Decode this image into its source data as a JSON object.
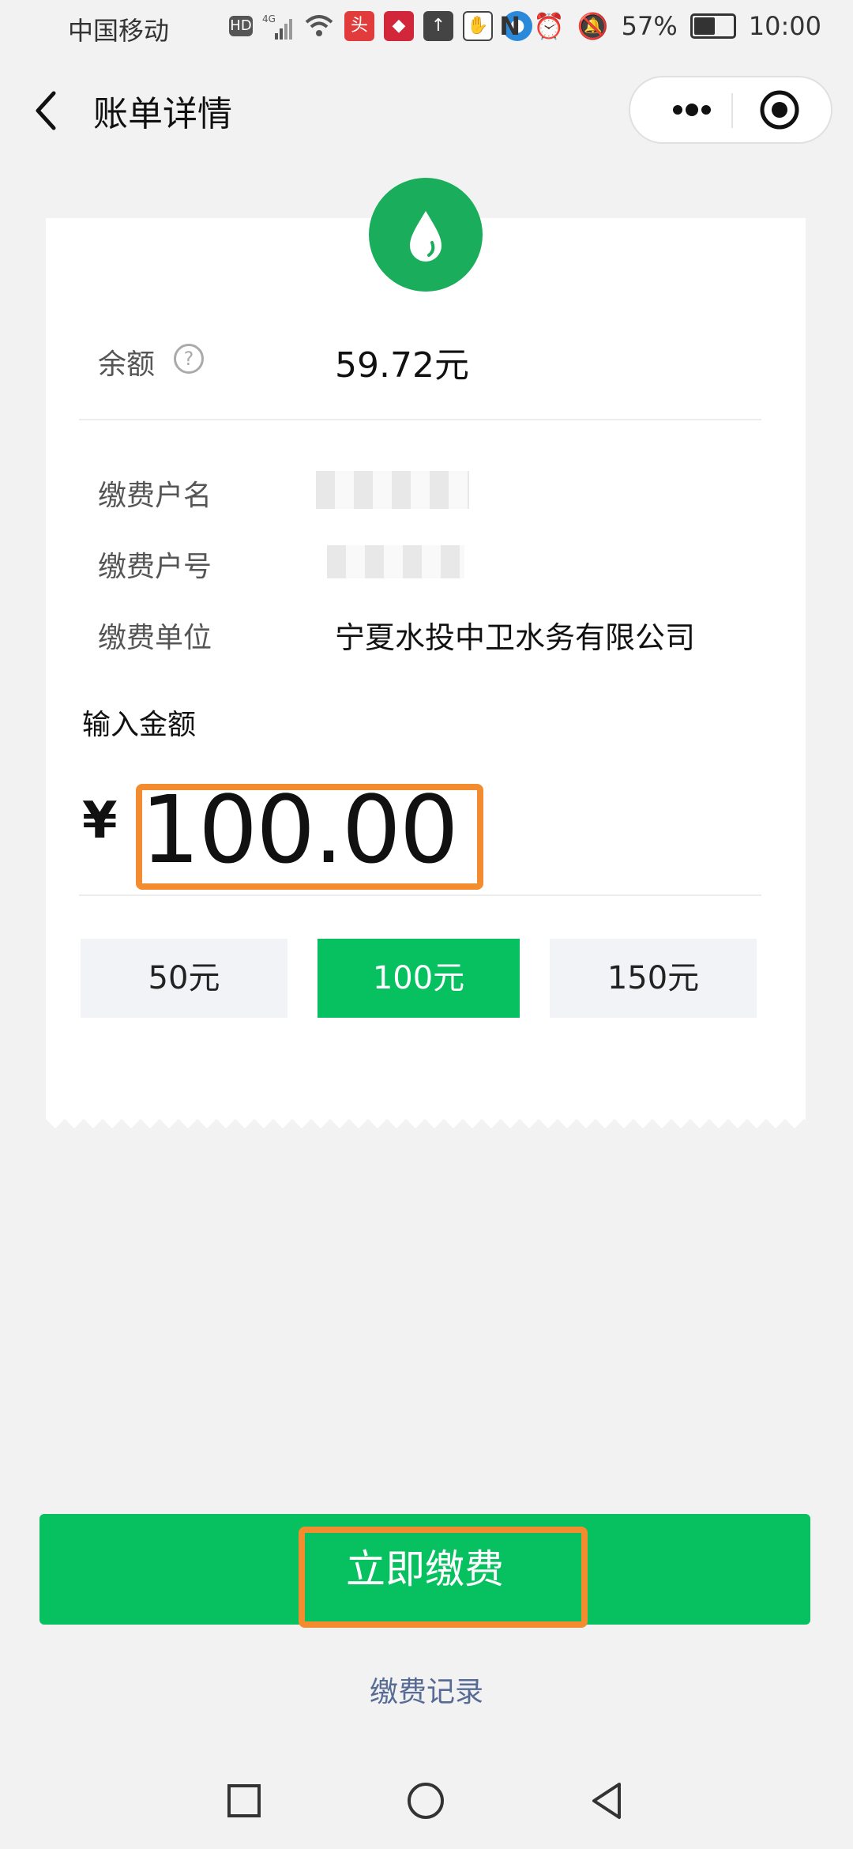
{
  "status_bar": {
    "carrier": "中国移动",
    "battery": "57%",
    "battery_level": 0.57,
    "time": "10:00",
    "icons": [
      "hd-icon",
      "signal-4g-icon",
      "wifi-icon",
      "toutiao-app-icon",
      "red-app-icon",
      "upload-icon",
      "hand-icon",
      "blue-app-icon",
      "nfc-icon",
      "alarm-icon",
      "mute-icon"
    ]
  },
  "header": {
    "title": "账单详情",
    "back_icon": "chevron-left-icon",
    "more_icon": "more-dots-icon",
    "close_icon": "target-circle-icon"
  },
  "bill": {
    "icon": "water-drop-icon",
    "balance_label": "余额",
    "balance_value": "59.72元",
    "rows": [
      {
        "label": "缴费户名"
      },
      {
        "label": "缴费户号"
      },
      {
        "label": "缴费单位",
        "value": "宁夏水投中卫水务有限公司"
      }
    ],
    "input_label": "输入金额",
    "currency": "¥",
    "amount": "100.00",
    "quick_amounts": [
      {
        "label": "50元",
        "selected": false
      },
      {
        "label": "100元",
        "selected": true
      },
      {
        "label": "150元",
        "selected": false
      }
    ]
  },
  "actions": {
    "pay_label": "立即缴费",
    "records_label": "缴费记录"
  },
  "nav": [
    "square-icon",
    "circle-home-icon",
    "triangle-back-icon"
  ],
  "colors": {
    "accent": "#07c160",
    "drop_circle": "#1aad5b",
    "highlight": "#f28c2f",
    "link": "#576b95"
  }
}
